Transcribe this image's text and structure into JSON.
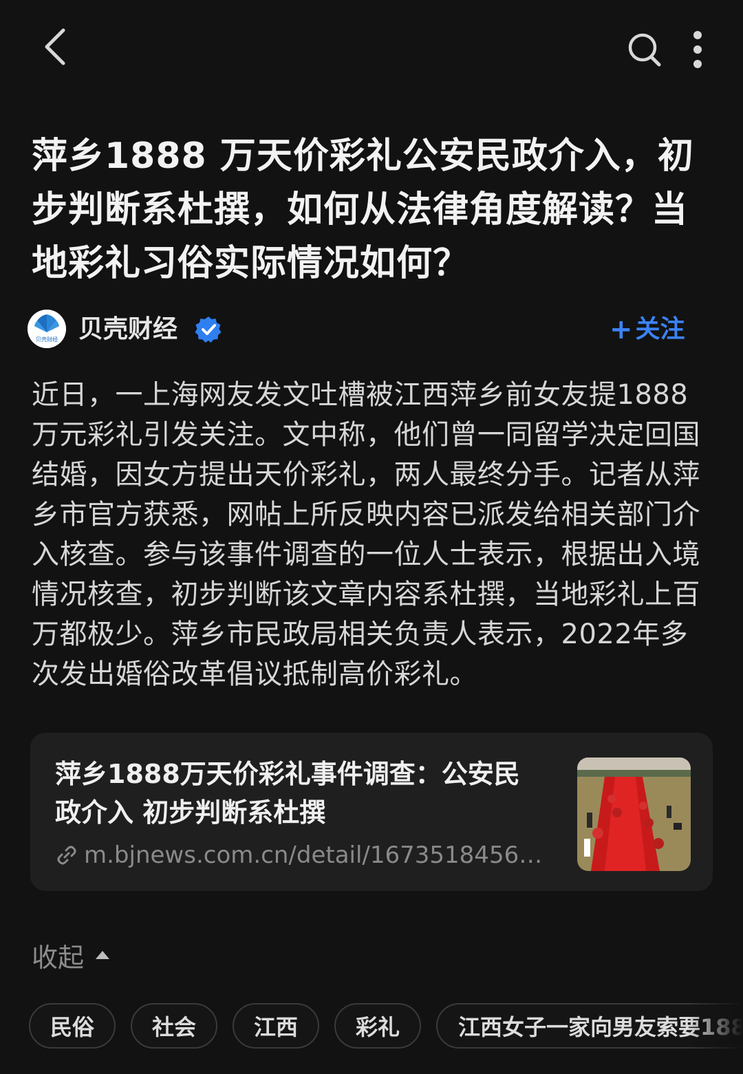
{
  "header": {
    "back_icon": "chevron-left-icon",
    "search_icon": "search-icon",
    "more_icon": "more-vertical-icon"
  },
  "article": {
    "title": "萍乡1888 万天价彩礼公安民政介入，初步判断系杜撰，如何从法律角度解读？当地彩礼习俗实际情况如何？",
    "author": "贝壳财经",
    "avatar_text": "贝壳财经",
    "verified_icon": "verified-badge-icon",
    "follow_label": "关注",
    "body": "近日，一上海网友发文吐槽被江西萍乡前女友提1888万元彩礼引发关注。文中称，他们曾一同留学决定回国结婚，因女方提出天价彩礼，两人最终分手。记者从萍乡市官方获悉，网帖上所反映内容已派发给相关部门介入核查。参与该事件调查的一位人士表示，根据出入境情况核查，初步判断该文章内容系杜撰，当地彩礼上百万都极少。萍乡市民政局相关负责人表示，2022年多次发出婚俗改革倡议抵制高价彩礼。"
  },
  "link_card": {
    "title": "萍乡1888万天价彩礼事件调查：公安民政介入 初步判断系杜撰",
    "url": "m.bjnews.com.cn/detail/16735184561...",
    "link_icon": "link-icon"
  },
  "collapse": {
    "label": "收起",
    "icon": "caret-up-icon"
  },
  "tags": [
    "民俗",
    "社会",
    "江西",
    "彩礼",
    "江西女子一家向男友索要188"
  ],
  "colors": {
    "background": "#121212",
    "accent": "#3b82f6",
    "card": "#1f1f1f"
  }
}
